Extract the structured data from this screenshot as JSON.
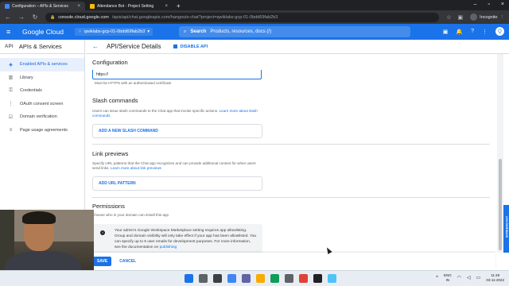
{
  "browser": {
    "tabs": [
      {
        "title": "Configuration – APIs & Services",
        "active": true
      },
      {
        "title": "Attendance Bot - Project Setting",
        "active": false
      }
    ],
    "url_host": "console.cloud.google.com",
    "url_path": "/apis/api/chat.googleapis.com/hangouts-chat?project=qwiklabs-gcp-01-0bdd69fab2b3",
    "profile_label": "Incognito"
  },
  "header": {
    "product": "Google Cloud",
    "project": "qwiklabs-gcp-01-0bdd69fab2b3",
    "search_label": "Search",
    "search_placeholder": "Products, resources, docs (/)",
    "avatar_letter": "Q"
  },
  "sidebar": {
    "badge": "API",
    "title": "APIs & Services",
    "items": [
      {
        "label": "Enabled APIs & services",
        "icon": "grid-icon",
        "glyph": "◈",
        "active": true
      },
      {
        "label": "Library",
        "icon": "library-icon",
        "glyph": "▥",
        "active": false
      },
      {
        "label": "Credentials",
        "icon": "key-icon",
        "glyph": "⚿",
        "active": false
      },
      {
        "label": "OAuth consent screen",
        "icon": "consent-icon",
        "glyph": "⋮",
        "active": false
      },
      {
        "label": "Domain verification",
        "icon": "checkbox-icon",
        "glyph": "☑",
        "active": false
      },
      {
        "label": "Page usage agreements",
        "icon": "settings-list-icon",
        "glyph": "≡",
        "active": false
      }
    ]
  },
  "page": {
    "title": "API/Service Details",
    "disable_label": "DISABLE API",
    "section_heading": "Configuration"
  },
  "config": {
    "url_value": "https://",
    "url_hint": "Must be HTTPS with an authenticated certificate",
    "slash": {
      "title": "Slash commands",
      "desc": "Users can issue slash commands to the Chat app that invoke specific actions.",
      "link": "Learn more about slash commands",
      "button": "ADD A NEW SLASH COMMAND"
    },
    "links": {
      "title": "Link previews",
      "desc": "Specify URL patterns that the Chat app recognizes and can provide additional context for when users send links.",
      "link": "Learn more about link previews",
      "button": "ADD URL PATTERN"
    },
    "permissions": {
      "title": "Permissions",
      "desc": "Choose who in your domain can install this app",
      "info_text": "Your admin's Google Workspace Marketplace setting requires app allowlisting. Group and domain visibility will only take effect if your app has been allowlisted. You can specify up to 5 user emails for development purposes. For more information, see the documentation on",
      "info_link": "publishing"
    }
  },
  "actions": {
    "save": "SAVE",
    "cancel": "CANCEL"
  },
  "taskbar": {
    "lang_top": "ENG",
    "lang_bottom": "IN",
    "time": "11:49",
    "date": "03-11-2022",
    "icons": [
      {
        "name": "windows-start-icon",
        "color": "#1a73e8"
      },
      {
        "name": "search-icon",
        "color": "#5f6368"
      },
      {
        "name": "task-view-icon",
        "color": "#3c4043"
      },
      {
        "name": "widgets-icon",
        "color": "#4285f4"
      },
      {
        "name": "teams-chat-icon",
        "color": "#6264a7"
      },
      {
        "name": "file-explorer-icon",
        "color": "#f9ab00"
      },
      {
        "name": "edge-icon",
        "color": "#0f9d58"
      },
      {
        "name": "store-icon",
        "color": "#5f6368"
      },
      {
        "name": "chrome-icon",
        "color": "#db4437"
      },
      {
        "name": "dev-tool-icon",
        "color": "#202124"
      },
      {
        "name": "notepad-icon",
        "color": "#4fc3f7"
      }
    ]
  },
  "colors": {
    "accent": "#1a73e8",
    "chrome_dark": "#202124"
  }
}
